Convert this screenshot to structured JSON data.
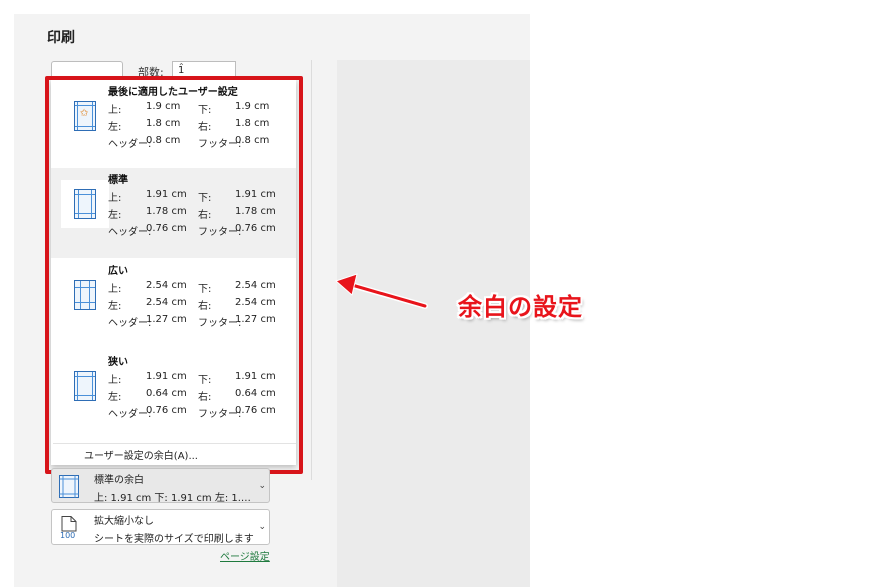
{
  "pane": {
    "title": "印刷"
  },
  "copies": {
    "label": "部数:",
    "value": "1",
    "spin": "⌃"
  },
  "margins_dropdown": {
    "options": [
      {
        "name": "最後に適用したユーザー設定",
        "top_label": "上:",
        "top": "1.9 cm",
        "bottom_label": "下:",
        "bottom": "1.9 cm",
        "left_label": "左:",
        "left": "1.8 cm",
        "right_label": "右:",
        "right": "1.8 cm",
        "header_label": "ヘッダー:",
        "header": "0.8 cm",
        "footer_label": "フッター:",
        "footer": "0.8 cm"
      },
      {
        "name": "標準",
        "top_label": "上:",
        "top": "1.91 cm",
        "bottom_label": "下:",
        "bottom": "1.91 cm",
        "left_label": "左:",
        "left": "1.78 cm",
        "right_label": "右:",
        "right": "1.78 cm",
        "header_label": "ヘッダー:",
        "header": "0.76 cm",
        "footer_label": "フッター:",
        "footer": "0.76 cm"
      },
      {
        "name": "広い",
        "top_label": "上:",
        "top": "2.54 cm",
        "bottom_label": "下:",
        "bottom": "2.54 cm",
        "left_label": "左:",
        "left": "2.54 cm",
        "right_label": "右:",
        "right": "2.54 cm",
        "header_label": "ヘッダー:",
        "header": "1.27 cm",
        "footer_label": "フッター:",
        "footer": "1.27 cm"
      },
      {
        "name": "狭い",
        "top_label": "上:",
        "top": "1.91 cm",
        "bottom_label": "下:",
        "bottom": "1.91 cm",
        "left_label": "左:",
        "left": "0.64 cm",
        "right_label": "右:",
        "right": "0.64 cm",
        "header_label": "ヘッダー:",
        "header": "0.76 cm",
        "footer_label": "フッター:",
        "footer": "0.76 cm"
      }
    ],
    "custom_margins_link": "ユーザー設定の余白(A)..."
  },
  "margin_control": {
    "title": "標準の余白",
    "detail": "上: 1.91 cm 下: 1.91 cm 左: 1.…",
    "chevron": "⌄"
  },
  "scaling_control": {
    "title": "拡大縮小なし",
    "detail": "シートを実際のサイズで印刷します",
    "icon_text": "100",
    "chevron": "⌄"
  },
  "page_setup_link": "ページ設定",
  "annotation": {
    "text": "余白の設定",
    "color": "#e8141b"
  },
  "colors": {
    "highlight_frame": "#d7141a",
    "margin_icon_blue": "#2e6db5",
    "link_green": "#1f7a3e"
  }
}
